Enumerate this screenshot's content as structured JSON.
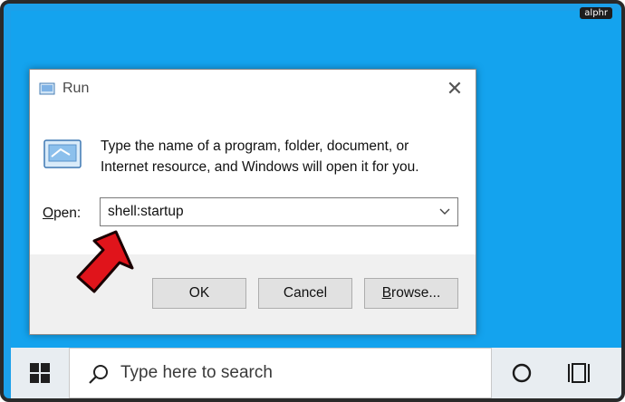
{
  "watermark": "alphr",
  "dialog": {
    "title": "Run",
    "close_glyph": "✕",
    "description_line1": "Type the name of a program, folder, document, or",
    "description_line2": "Internet resource, and Windows will open it for you.",
    "open_label_underlined": "O",
    "open_label_rest": "pen:",
    "open_value": "shell:startup",
    "buttons": {
      "ok": "OK",
      "cancel": "Cancel",
      "browse_underlined": "B",
      "browse_rest": "rowse..."
    }
  },
  "taskbar": {
    "search_placeholder": "Type here to search"
  },
  "icons": [
    "run-app-icon",
    "close-icon",
    "chevron-down-icon",
    "windows-start-icon",
    "search-icon",
    "cortana-circle-icon",
    "task-view-icon",
    "red-pointer-arrow-icon"
  ],
  "colors": {
    "desktop": "#14a3ee",
    "taskbar": "#e8edf1",
    "arrow": "#e0141b"
  }
}
